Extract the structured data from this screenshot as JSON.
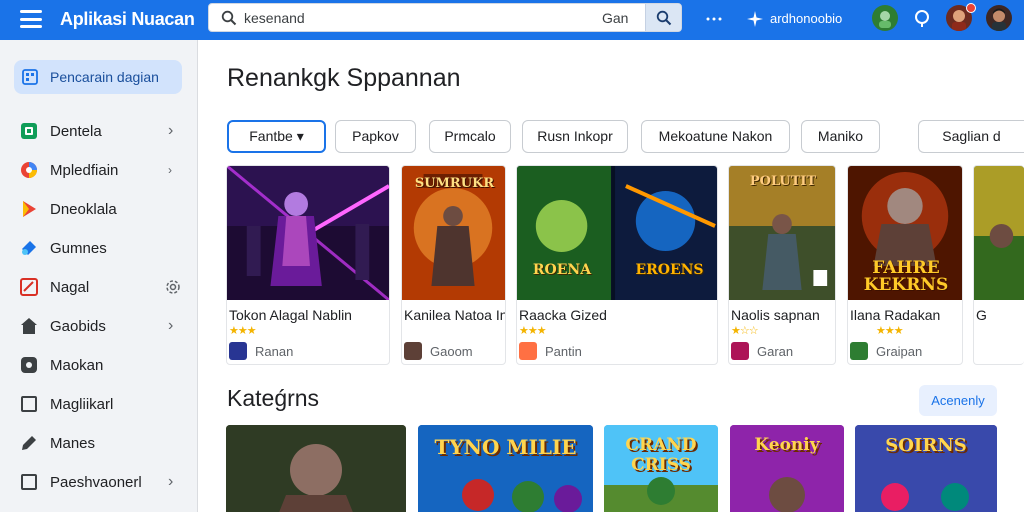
{
  "header": {
    "app_title": "Aplikasi Nuacan",
    "search": {
      "value": "kesenand",
      "scope": "Gan"
    },
    "account_text": "ardhonoobio",
    "icons": [
      "menu-icon",
      "search-icon",
      "apps-icon",
      "sparkle-icon",
      "shield-icon",
      "help-icon",
      "notification-avatar",
      "profile-avatar"
    ]
  },
  "sidebar": {
    "primary": {
      "label": "Pencarain dagian",
      "icon": "grid-icon"
    },
    "items": [
      {
        "label": "Dentela",
        "icon": "square-green-icon",
        "chevron": true
      },
      {
        "label": "Mpledfiain",
        "icon": "circle-multicolor-icon",
        "chevron": true
      },
      {
        "label": "Dneoklala",
        "icon": "play-triangle-icon",
        "chevron": false
      },
      {
        "label": "Gumnes",
        "icon": "arrow-blue-icon",
        "chevron": false
      },
      {
        "label": "Nagal",
        "icon": "red-square-icon",
        "chevron": false,
        "extra_icon": "settings-gear-icon"
      },
      {
        "label": "Gaobids",
        "icon": "home-icon",
        "chevron": true
      },
      {
        "label": "Maokan",
        "icon": "dark-square-icon",
        "chevron": false
      },
      {
        "label": "Magliikarl",
        "icon": "outline-square-icon",
        "chevron": false
      },
      {
        "label": "Manes",
        "icon": "pencil-icon",
        "chevron": false
      },
      {
        "label": "Paeshvaonerl",
        "icon": "outline-square-icon",
        "chevron": true
      }
    ]
  },
  "main": {
    "title": "Renankgk Sppannan",
    "chips": [
      "Fantbe ▾",
      "Papkov",
      "Prmcalo",
      "Rusn Inkopr",
      "Mekoatune Nakon",
      "Maniko",
      "Saglian d"
    ],
    "apps": [
      {
        "name": "Tokon Alagal Nablin",
        "stars": "★★★",
        "developer": "Ranan",
        "accent": "#7b2ff7"
      },
      {
        "name": "Kanilea Natoa Inlaplia",
        "stars": "",
        "developer": "Gaoom",
        "accent": "#e65100"
      },
      {
        "name": "Raacka Gized",
        "stars": "★★★",
        "developer": "Pantin",
        "accent": "#1e88e5"
      },
      {
        "name": "Naolis sapnan",
        "stars": "★☆☆",
        "developer": "Garan",
        "accent": "#8d6e63"
      },
      {
        "name": "Ilana Radakan",
        "stars": "★★★",
        "developer": "Graipan",
        "accent": "#bf360c"
      },
      {
        "name": "G",
        "stars": "",
        "developer": "",
        "accent": "#5d4037"
      }
    ],
    "art_labels": [
      "SUMRUKR",
      "ROENA",
      "EROENS",
      "POLUTIT",
      "FAHRE KEKRNS",
      ""
    ],
    "section_title": "Kateǵrns",
    "see_all": "Acenenly",
    "categories": [
      "",
      "TYNO MILIE",
      "CRAND CRISS",
      "Keoniy",
      "SOIRNS"
    ]
  }
}
